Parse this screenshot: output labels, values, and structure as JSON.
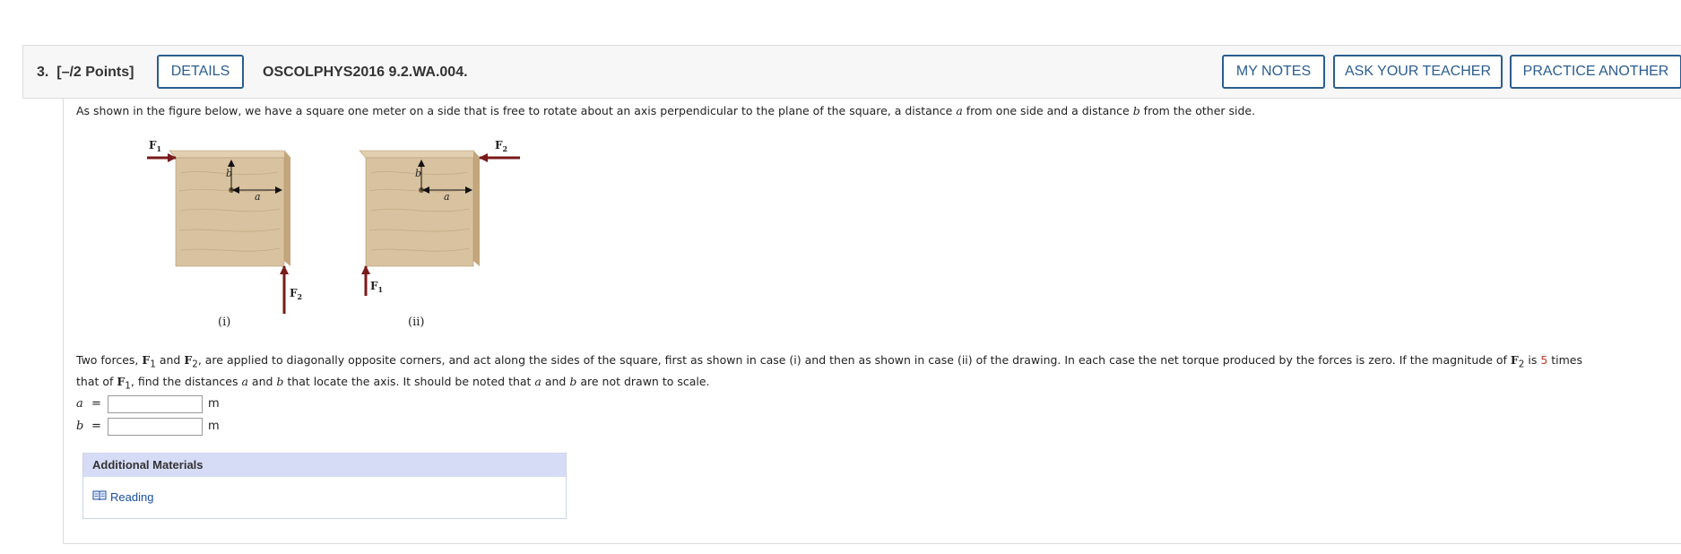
{
  "header": {
    "question_number": "3.",
    "points": "[–/2 Points]",
    "details_label": "DETAILS",
    "code": "OSCOLPHYS2016 9.2.WA.004.",
    "my_notes_label": "MY NOTES",
    "ask_teacher_label": "ASK YOUR TEACHER",
    "practice_label": "PRACTICE ANOTHER"
  },
  "question": {
    "intro_1": "As shown in the figure below, we have a square one meter on a side that is free to rotate about an axis perpendicular to the plane of the square, a distance ",
    "var_a": "a",
    "intro_2": " from one side and a distance ",
    "var_b": "b",
    "intro_3": " from the other side.",
    "p2_1": "Two forces, ",
    "p2_2": " and ",
    "p2_3": ", are applied to diagonally opposite corners, and act along the sides of the square, first as shown in case (i) and then as shown in case (ii) of the drawing. In each case the net torque produced by the forces is zero. If the magnitude of ",
    "p2_4": " is ",
    "multiplier": "5",
    "p2_5": " times",
    "p3_1": "that of ",
    "p3_2": ", find the distances ",
    "p3_3": " and ",
    "p3_4": " that locate the axis. It should be noted that ",
    "p3_5": " and ",
    "p3_6": " are not drawn to scale.",
    "force1": "F",
    "force2": "F",
    "sub1": "1",
    "sub2": "2"
  },
  "figure": {
    "case_i_label": "(i)",
    "case_ii_label": "(ii)",
    "dim_a": "a",
    "dim_b": "b",
    "force_letter": "F",
    "sub1": "1",
    "sub2": "2"
  },
  "answers": [
    {
      "var": "a",
      "eq": "=",
      "value": "",
      "unit": "m"
    },
    {
      "var": "b",
      "eq": "=",
      "value": "",
      "unit": "m"
    }
  ],
  "additional": {
    "title": "Additional Materials",
    "reading_label": "Reading",
    "book_icon": "book-icon"
  }
}
